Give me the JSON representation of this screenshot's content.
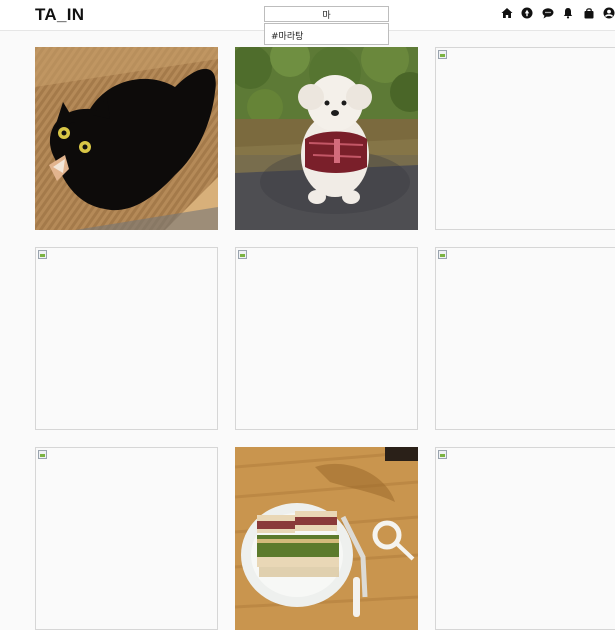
{
  "app": {
    "brand": "TA_IN"
  },
  "search": {
    "value": "마",
    "suggestions": [
      "#마라탕"
    ]
  },
  "nav": {
    "icons": [
      "home-icon",
      "explore-icon",
      "messages-icon",
      "notifications-icon",
      "shop-bag-icon",
      "profile-icon"
    ]
  },
  "feed": {
    "posts": [
      {
        "subject": "black-cat-photo",
        "loaded": true
      },
      {
        "subject": "white-dog-photo",
        "loaded": true
      },
      {
        "loaded": false
      },
      {
        "loaded": false
      },
      {
        "loaded": false
      },
      {
        "loaded": false
      },
      {
        "loaded": false
      },
      {
        "subject": "sandwich-photo",
        "loaded": true
      },
      {
        "loaded": false
      }
    ]
  }
}
